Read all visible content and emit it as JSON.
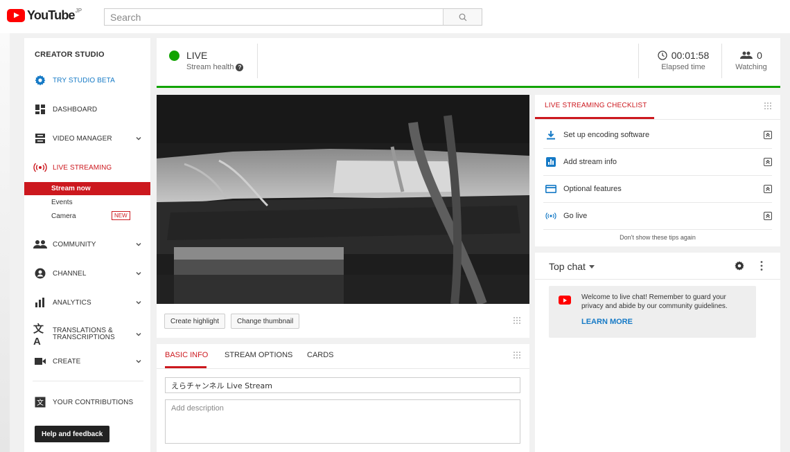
{
  "header": {
    "logo_text": "YouTube",
    "logo_region": "JP",
    "search_placeholder": "Search"
  },
  "sidebar": {
    "title": "CREATOR STUDIO",
    "try_beta": "TRY STUDIO BETA",
    "items": [
      {
        "label": "DASHBOARD",
        "icon": "dashboard-icon"
      },
      {
        "label": "VIDEO MANAGER",
        "icon": "video-manager-icon"
      },
      {
        "label": "LIVE STREAMING",
        "icon": "live-streaming-icon"
      },
      {
        "label": "COMMUNITY",
        "icon": "community-icon"
      },
      {
        "label": "CHANNEL",
        "icon": "channel-icon"
      },
      {
        "label": "ANALYTICS",
        "icon": "analytics-icon"
      },
      {
        "label": "TRANSLATIONS & TRANSCRIPTIONS",
        "icon": "translate-icon"
      },
      {
        "label": "CREATE",
        "icon": "create-icon"
      }
    ],
    "live_sub": [
      "Stream now",
      "Events",
      "Camera"
    ],
    "new_badge": "NEW",
    "contributions": "YOUR CONTRIBUTIONS",
    "help": "Help and feedback"
  },
  "status": {
    "live": "LIVE",
    "health": "Stream health",
    "elapsed_value": "00:01:58",
    "elapsed_label": "Elapsed time",
    "watching_value": "0",
    "watching_label": "Watching"
  },
  "video": {
    "create_highlight": "Create highlight",
    "change_thumbnail": "Change thumbnail"
  },
  "info": {
    "tabs": [
      "BASIC INFO",
      "STREAM OPTIONS",
      "CARDS"
    ],
    "title_value": "えらチャンネル Live Stream",
    "description_placeholder": "Add description"
  },
  "checklist": {
    "tab": "LIVE STREAMING CHECKLIST",
    "items": [
      {
        "label": "Set up encoding software",
        "icon": "download-icon"
      },
      {
        "label": "Add stream info",
        "icon": "stats-icon"
      },
      {
        "label": "Optional features",
        "icon": "card-icon"
      },
      {
        "label": "Go live",
        "icon": "live-icon"
      }
    ],
    "footer": "Don't show these tips again"
  },
  "chat": {
    "title": "Top chat",
    "welcome": "Welcome to live chat! Remember to guard your privacy and abide by our community guidelines.",
    "learn_more": "LEARN MORE"
  },
  "colors": {
    "brand_red": "#ff0000",
    "accent_red": "#cc181e",
    "live_green": "#11a400",
    "link_blue": "#167ac6"
  }
}
